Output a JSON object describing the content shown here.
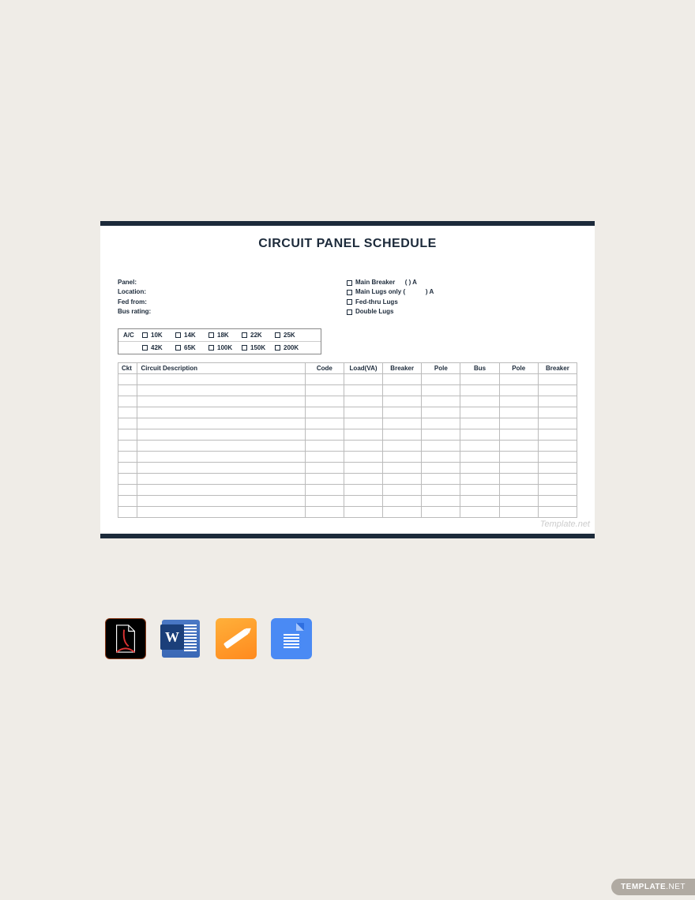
{
  "title": "CIRCUIT PANEL SCHEDULE",
  "info_left": {
    "panel": "Panel:",
    "location": "Location:",
    "fed_from": "Fed from:",
    "bus_rating": "Bus rating:"
  },
  "info_right": {
    "main_breaker": "Main Breaker",
    "main_breaker_suffix": "(           ) A",
    "main_lugs": "Main Lugs only (",
    "main_lugs_suffix": ") A",
    "fed_thru": "Fed-thru Lugs",
    "double_lugs": "Double Lugs"
  },
  "ac": {
    "label": "A/C",
    "row1": [
      "10K",
      "14K",
      "18K",
      "22K",
      "25K"
    ],
    "row2": [
      "42K",
      "65K",
      "100K",
      "150K",
      "200K"
    ]
  },
  "table": {
    "headers": [
      "Ckt",
      "Circuit Description",
      "Code",
      "Load(VA)",
      "Breaker",
      "Pole",
      "Bus",
      "Pole",
      "Breaker"
    ],
    "rows": 13
  },
  "watermark": "Template.net",
  "icons": {
    "pdf": "pdf-icon",
    "word": "word-icon",
    "pages": "pages-icon",
    "docs": "google-docs-icon"
  },
  "brand": {
    "main": "TEMPLATE",
    "net": ".NET"
  }
}
